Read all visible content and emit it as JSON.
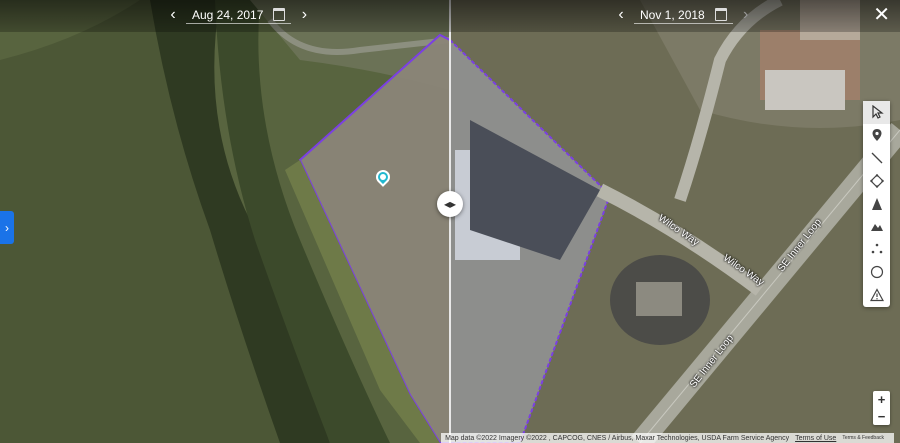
{
  "left_date": {
    "label": "Aug 24, 2017",
    "prev_icon": "chevron-left-icon",
    "next_icon": "chevron-right-icon"
  },
  "right_date": {
    "label": "Nov 1, 2018",
    "prev_icon": "chevron-left-icon",
    "next_icon": "chevron-right-icon"
  },
  "roads": {
    "wilco_way_1": "Wilco Way",
    "wilco_way_2": "Wilco Way",
    "se_inner_loop_1": "SE Inner Loop",
    "se_inner_loop_2": "SE Inner Loop"
  },
  "tools": [
    "cursor-icon",
    "placemark-icon",
    "line-icon",
    "polygon-icon",
    "elevation-icon",
    "terrain-icon",
    "points-icon",
    "circle-icon",
    "warning-icon"
  ],
  "zoom": {
    "in_label": "+",
    "out_label": "−"
  },
  "attribution": {
    "map_data": "Map data ©2022 Imagery ©2022 , CAPCOG, CNES / Airbus, Maxar Technologies, USDA Farm Service Agency",
    "terms": "Terms of Use",
    "feedback": "Terms & Feedback"
  },
  "colors": {
    "polygon": "#7b3fe4",
    "accent": "#1a73e8",
    "pin": "#22b8cf"
  }
}
